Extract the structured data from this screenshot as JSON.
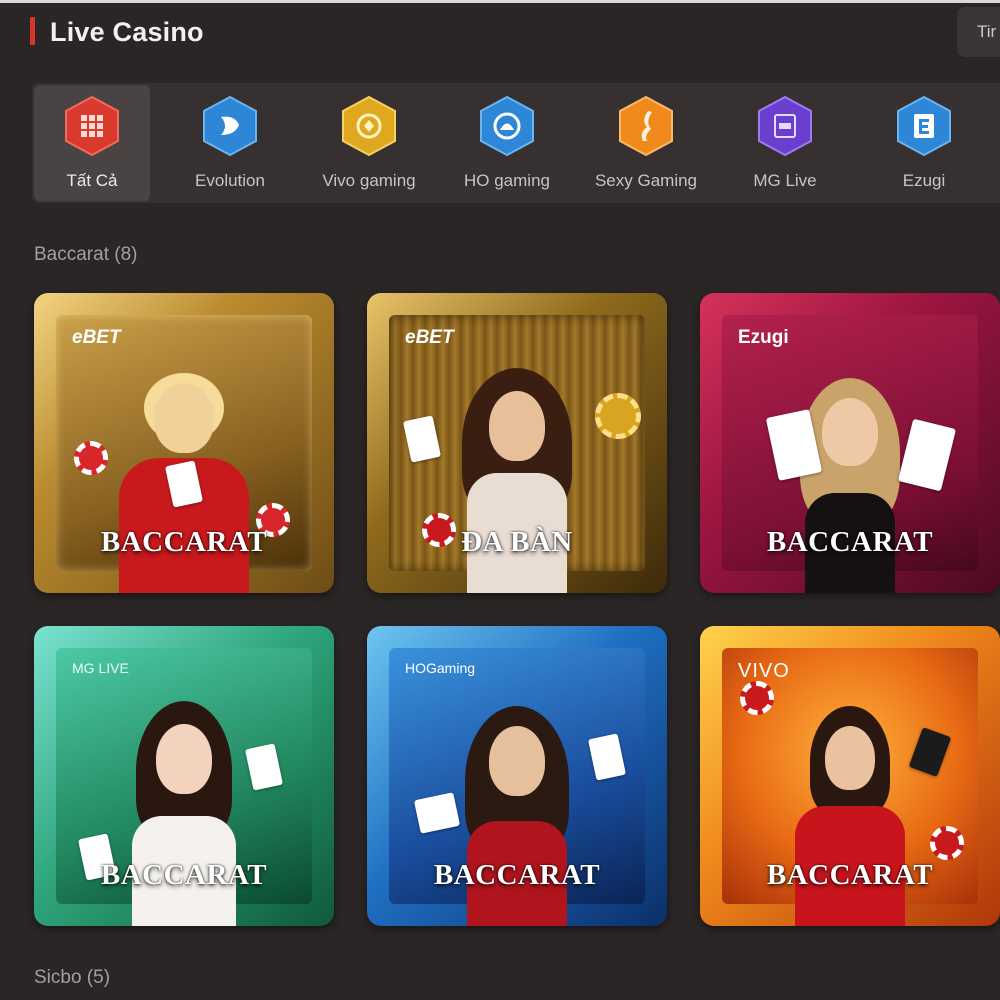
{
  "header": {
    "title": "Live Casino",
    "right_tab": "Tir"
  },
  "providers": [
    {
      "label": "Tất Cả",
      "icon": "grid-icon",
      "color": "#d83a2e",
      "active": true
    },
    {
      "label": "Evolution",
      "icon": "evolution-icon",
      "color": "#2e86d6",
      "active": false
    },
    {
      "label": "Vivo gaming",
      "icon": "vivo-icon",
      "color": "#e0a81e",
      "active": false
    },
    {
      "label": "HO gaming",
      "icon": "ho-gaming-icon",
      "color": "#2e86d6",
      "active": false
    },
    {
      "label": "Sexy Gaming",
      "icon": "sexy-gaming-icon",
      "color": "#f08a1c",
      "active": false
    },
    {
      "label": "MG Live",
      "icon": "mg-live-icon",
      "color": "#6a3fd0",
      "active": false
    },
    {
      "label": "Ezugi",
      "icon": "ezugi-icon",
      "color": "#2e86d6",
      "active": false
    }
  ],
  "sections": [
    {
      "title": "Baccarat (8)",
      "games": [
        {
          "label": "BACCARAT",
          "logo": "eBET",
          "theme": "gold"
        },
        {
          "label": "ĐA BÀN",
          "logo": "eBET",
          "theme": "gold-dark"
        },
        {
          "label": "BACCARAT",
          "logo": "Ezugi",
          "theme": "crimson"
        },
        {
          "label": "BACCARAT",
          "logo": "MG LIVE",
          "theme": "green"
        },
        {
          "label": "BACCARAT",
          "logo": "HOGaming",
          "theme": "blue"
        },
        {
          "label": "BACCARAT",
          "logo": "VIVO",
          "theme": "orange"
        }
      ]
    },
    {
      "title": "Sicbo (5)"
    }
  ]
}
